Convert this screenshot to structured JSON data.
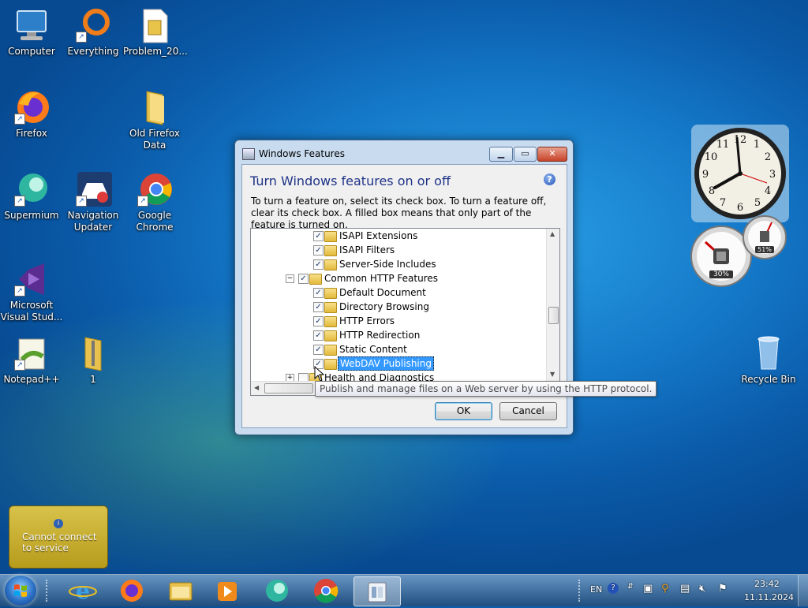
{
  "desktop": {
    "icons": [
      {
        "label": "Computer",
        "icon": "computer-icon"
      },
      {
        "label": "Everything",
        "icon": "everything-icon"
      },
      {
        "label": "Problem_20...",
        "icon": "document-icon"
      },
      {
        "label": "Firefox",
        "icon": "firefox-icon"
      },
      {
        "label": "Old Firefox Data",
        "icon": "folder-icon"
      },
      {
        "label": "Supermium",
        "icon": "supermium-icon"
      },
      {
        "label": "Navigation Updater",
        "icon": "navigation-updater-icon"
      },
      {
        "label": "Google Chrome",
        "icon": "chrome-icon"
      },
      {
        "label": "Microsoft Visual Stud...",
        "icon": "visual-studio-icon"
      },
      {
        "label": "Notepad++",
        "icon": "notepadpp-icon"
      },
      {
        "label": "1",
        "icon": "zip-folder-icon"
      },
      {
        "label": "Recycle Bin",
        "icon": "recycle-bin-icon"
      }
    ]
  },
  "gadgets": {
    "cpu_percent": "30%",
    "memory_percent": "51%",
    "weather_message": "Cannot connect to service"
  },
  "dialog": {
    "title": "Windows Features",
    "heading": "Turn Windows features on or off",
    "description": "To turn a feature on, select its check box. To turn a feature off, clear its check box. A filled box means that only part of the feature is turned on.",
    "tree": [
      {
        "label": "ISAPI Extensions",
        "checked": true,
        "level": 2
      },
      {
        "label": "ISAPI Filters",
        "checked": true,
        "level": 2
      },
      {
        "label": "Server-Side Includes",
        "checked": true,
        "level": 2
      },
      {
        "label": "Common HTTP Features",
        "checked": true,
        "level": 1,
        "expander": "-"
      },
      {
        "label": "Default Document",
        "checked": true,
        "level": 2
      },
      {
        "label": "Directory Browsing",
        "checked": true,
        "level": 2
      },
      {
        "label": "HTTP Errors",
        "checked": true,
        "level": 2
      },
      {
        "label": "HTTP Redirection",
        "checked": true,
        "level": 2
      },
      {
        "label": "Static Content",
        "checked": true,
        "level": 2
      },
      {
        "label": "WebDAV Publishing",
        "checked": true,
        "level": 2,
        "selected": true
      },
      {
        "label": "Health and Diagnostics",
        "checked": false,
        "level": 1,
        "expander": "+"
      }
    ],
    "tooltip": "Publish and manage files on a Web server by using the HTTP protocol.",
    "ok_label": "OK",
    "cancel_label": "Cancel"
  },
  "taskbar": {
    "apps": [
      "internet-explorer-icon",
      "firefox-icon",
      "explorer-icon",
      "media-player-icon",
      "supermium-icon",
      "chrome-icon",
      "windows-features-icon"
    ],
    "language": "EN",
    "time": "23:42",
    "date": "11.11.2024"
  },
  "colors": {
    "accent_blue": "#3399ff",
    "heading_blue": "#1e3287",
    "desktop_blue": "#1478c8"
  }
}
